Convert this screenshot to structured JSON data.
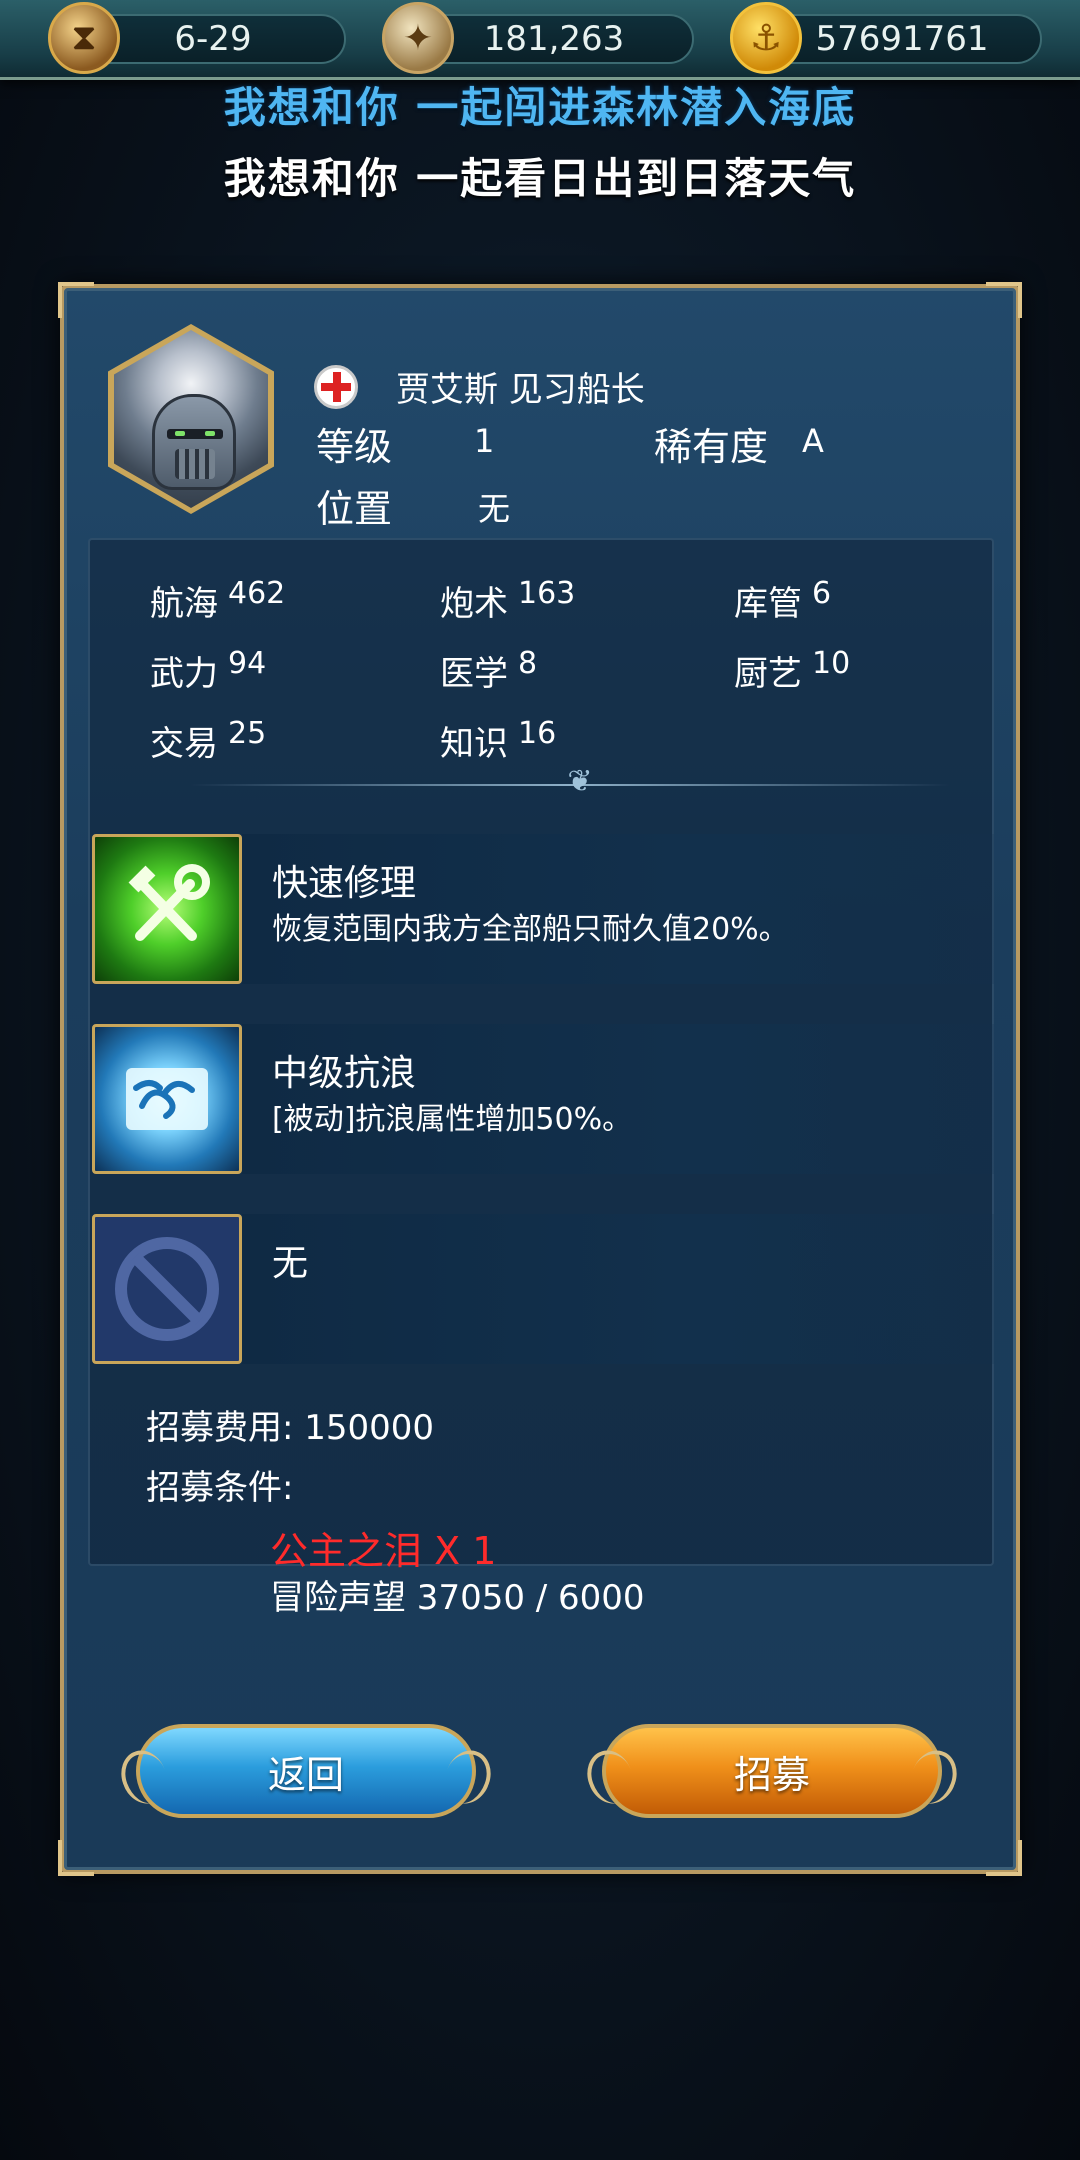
{
  "topbar": {
    "stage": "6-29",
    "compass_value": "181,263",
    "gold": "57691761"
  },
  "lyrics": {
    "line1": "我想和你 一起闯进森林潜入海底",
    "line2": "我想和你 一起看日出到日落天气"
  },
  "captain": {
    "name": "贾艾斯 见习船长",
    "level_label": "等级",
    "level_value": "1",
    "rarity_label": "稀有度",
    "rarity_value": "A",
    "position_label": "位置",
    "position_value": "无"
  },
  "stats": [
    {
      "label": "航海",
      "value": "462"
    },
    {
      "label": "炮术",
      "value": "163"
    },
    {
      "label": "库管",
      "value": "6"
    },
    {
      "label": "武力",
      "value": "94"
    },
    {
      "label": "医学",
      "value": "8"
    },
    {
      "label": "厨艺",
      "value": "10"
    },
    {
      "label": "交易",
      "value": "25"
    },
    {
      "label": "知识",
      "value": "16"
    }
  ],
  "skills": [
    {
      "name": "快速修理",
      "desc": "恢复范围内我方全部船只耐久值20%。",
      "icon": "repair-icon"
    },
    {
      "name": "中级抗浪",
      "desc": "[被动]抗浪属性增加50%。",
      "icon": "wave-icon"
    },
    {
      "name": "无",
      "desc": "",
      "icon": "no-skill-icon"
    }
  ],
  "recruit": {
    "cost_text": "招募费用: 150000",
    "condition_label": "招募条件:",
    "requirement_item": "公主之泪 X 1",
    "requirement_reputation": "冒险声望 37050 / 6000"
  },
  "buttons": {
    "back": "返回",
    "recruit": "招募"
  },
  "colors": {
    "lyric_accent": "#4fb6f2",
    "requirement_red": "#ff2b2b",
    "button_back": "#2b9ddd",
    "button_recruit": "#f0901a",
    "frame_gold": "#c9a65a"
  }
}
